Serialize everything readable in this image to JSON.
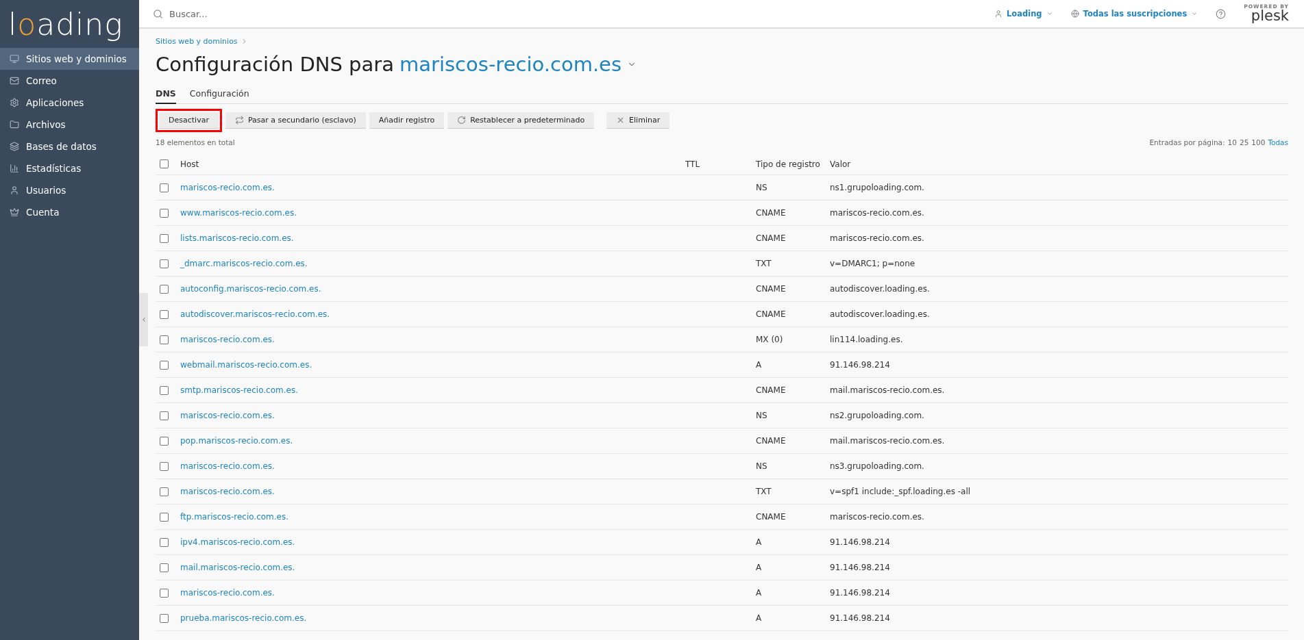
{
  "logo": {
    "text": "loading"
  },
  "sidebar": {
    "items": [
      {
        "label": "Sitios web y dominios",
        "selected": true
      },
      {
        "label": "Correo",
        "selected": false
      },
      {
        "label": "Aplicaciones",
        "selected": false
      },
      {
        "label": "Archivos",
        "selected": false
      },
      {
        "label": "Bases de datos",
        "selected": false
      },
      {
        "label": "Estadísticas",
        "selected": false
      },
      {
        "label": "Usuarios",
        "selected": false
      },
      {
        "label": "Cuenta",
        "selected": false
      }
    ]
  },
  "header": {
    "search": {
      "placeholder": "Buscar..."
    },
    "user": "Loading",
    "subscriptions": "Todas las suscripciones",
    "brand": {
      "powered": "POWERED BY",
      "name": "plesk"
    }
  },
  "breadcrumb": "Sitios web y dominios",
  "title": {
    "prefix": "Configuración DNS para",
    "domain": "mariscos-recio.com.es"
  },
  "tabs": [
    {
      "label": "DNS",
      "selected": true
    },
    {
      "label": "Configuración",
      "selected": false
    }
  ],
  "toolbar": [
    {
      "label": "Desactivar",
      "highlighted": true
    },
    {
      "label": "Pasar a secundario (esclavo)",
      "highlighted": false
    },
    {
      "label": "Añadir registro",
      "highlighted": false
    },
    {
      "label": "Restablecer a predeterminado",
      "highlighted": false
    },
    {
      "label": "Eliminar",
      "highlighted": false
    }
  ],
  "total": "18 elementos en total",
  "pager": {
    "label": "Entradas por página:",
    "options": [
      {
        "label": "10",
        "selected": true
      },
      {
        "label": "25",
        "selected": true
      },
      {
        "label": "100",
        "selected": true
      },
      {
        "label": "Todas",
        "selected": false
      }
    ]
  },
  "table": {
    "columns": [
      "Host",
      "TTL",
      "Tipo de registro",
      "Valor"
    ],
    "select_all": false,
    "rows": [
      {
        "host": "mariscos-recio.com.es.",
        "type": "NS",
        "value": "ns1.grupoloading.com.",
        "checked": false
      },
      {
        "host": "www.mariscos-recio.com.es.",
        "type": "CNAME",
        "value": "mariscos-recio.com.es.",
        "checked": false
      },
      {
        "host": "lists.mariscos-recio.com.es.",
        "type": "CNAME",
        "value": "mariscos-recio.com.es.",
        "checked": false
      },
      {
        "host": "_dmarc.mariscos-recio.com.es.",
        "type": "TXT",
        "value": "v=DMARC1; p=none",
        "checked": false
      },
      {
        "host": "autoconfig.mariscos-recio.com.es.",
        "type": "CNAME",
        "value": "autodiscover.loading.es.",
        "checked": false
      },
      {
        "host": "autodiscover.mariscos-recio.com.es.",
        "type": "CNAME",
        "value": "autodiscover.loading.es.",
        "checked": false
      },
      {
        "host": "mariscos-recio.com.es.",
        "type": "MX (0)",
        "value": "lin114.loading.es.",
        "checked": false
      },
      {
        "host": "webmail.mariscos-recio.com.es.",
        "type": "A",
        "value": "91.146.98.214",
        "checked": false
      },
      {
        "host": "smtp.mariscos-recio.com.es.",
        "type": "CNAME",
        "value": "mail.mariscos-recio.com.es.",
        "checked": false
      },
      {
        "host": "mariscos-recio.com.es.",
        "type": "NS",
        "value": "ns2.grupoloading.com.",
        "checked": false
      },
      {
        "host": "pop.mariscos-recio.com.es.",
        "type": "CNAME",
        "value": "mail.mariscos-recio.com.es.",
        "checked": false
      },
      {
        "host": "mariscos-recio.com.es.",
        "type": "NS",
        "value": "ns3.grupoloading.com.",
        "checked": false
      },
      {
        "host": "mariscos-recio.com.es.",
        "type": "TXT",
        "value": "v=spf1 include:_spf.loading.es -all",
        "checked": false
      },
      {
        "host": "ftp.mariscos-recio.com.es.",
        "type": "CNAME",
        "value": "mariscos-recio.com.es.",
        "checked": false
      },
      {
        "host": "ipv4.mariscos-recio.com.es.",
        "type": "A",
        "value": "91.146.98.214",
        "checked": false
      },
      {
        "host": "mail.mariscos-recio.com.es.",
        "type": "A",
        "value": "91.146.98.214",
        "checked": false
      },
      {
        "host": "mariscos-recio.com.es.",
        "type": "A",
        "value": "91.146.98.214",
        "checked": false
      },
      {
        "host": "prueba.mariscos-recio.com.es.",
        "type": "A",
        "value": "91.146.98.214",
        "checked": false
      }
    ]
  }
}
